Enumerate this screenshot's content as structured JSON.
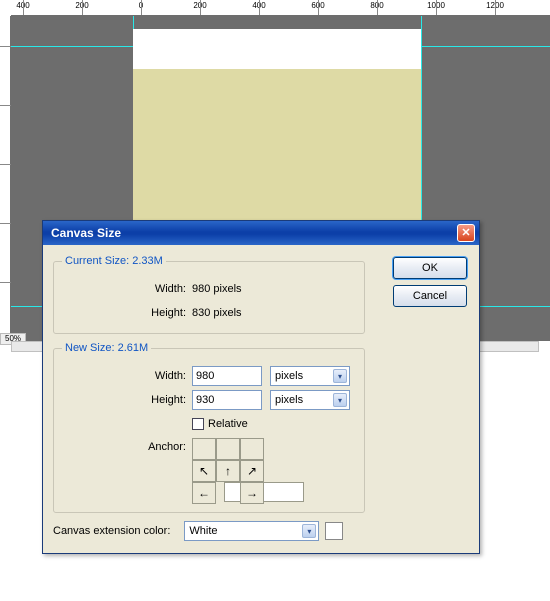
{
  "editor": {
    "zoom": "50%"
  },
  "dialog": {
    "title": "Canvas Size",
    "currentSize": {
      "legend": "Current Size: 2.33M",
      "widthLabel": "Width:",
      "widthValue": "980 pixels",
      "heightLabel": "Height:",
      "heightValue": "830 pixels"
    },
    "newSize": {
      "legend": "New Size: 2.61M",
      "widthLabel": "Width:",
      "widthValue": "980",
      "widthUnit": "pixels",
      "heightLabel": "Height:",
      "heightValue": "930",
      "heightUnit": "pixels",
      "relativeLabel": "Relative",
      "anchorLabel": "Anchor:"
    },
    "ext": {
      "label": "Canvas extension color:",
      "value": "White"
    },
    "buttons": {
      "ok": "OK",
      "cancel": "Cancel"
    }
  }
}
